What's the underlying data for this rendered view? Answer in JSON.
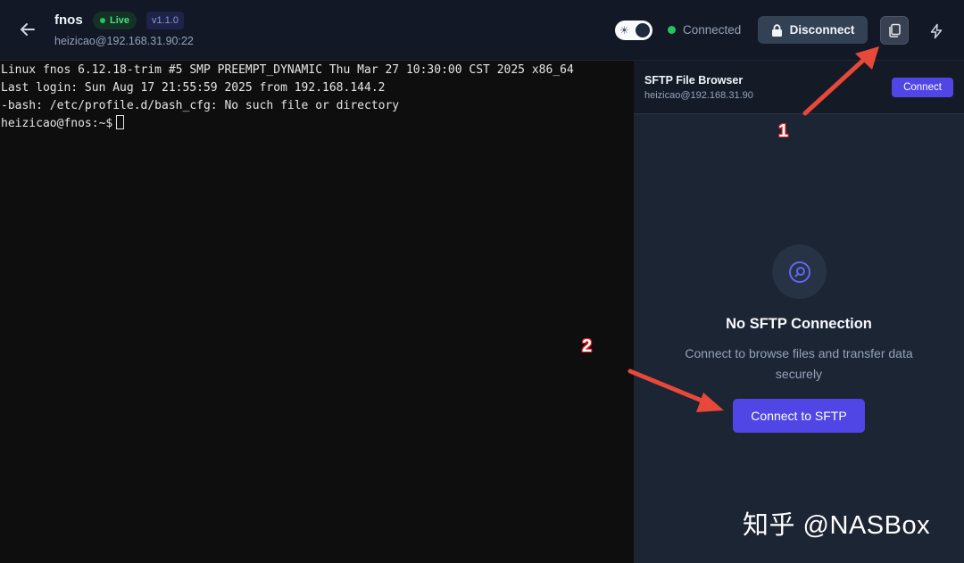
{
  "header": {
    "title": "fnos",
    "live_label": "Live",
    "version": "v1.1.0",
    "subtitle": "heizicao@192.168.31.90:22",
    "status": "Connected",
    "disconnect_label": "Disconnect",
    "icons": [
      "back-arrow-icon",
      "sun-icon",
      "lock-icon",
      "copy-icon",
      "lightning-icon"
    ]
  },
  "terminal": {
    "lines": [
      "Linux fnos 6.12.18-trim #5 SMP PREEMPT_DYNAMIC Thu Mar 27 10:30:00 CST 2025 x86_64",
      "Last login: Sun Aug 17 21:55:59 2025 from 192.168.144.2",
      "-bash: /etc/profile.d/bash_cfg: No such file or directory",
      "heizicao@fnos:~$"
    ]
  },
  "sftp": {
    "title": "SFTP File Browser",
    "host": "heizicao@192.168.31.90",
    "connect_label": "Connect",
    "empty_title": "No SFTP Connection",
    "empty_desc": "Connect to browse files and transfer data securely",
    "connect_sftp_label": "Connect to SFTP"
  },
  "annotations": {
    "step1": "1",
    "step2": "2",
    "arrow_color": "#e8483a"
  },
  "watermark": "知乎 @NASBox",
  "colors": {
    "accent": "#4f46e5",
    "success": "#22c55e"
  }
}
